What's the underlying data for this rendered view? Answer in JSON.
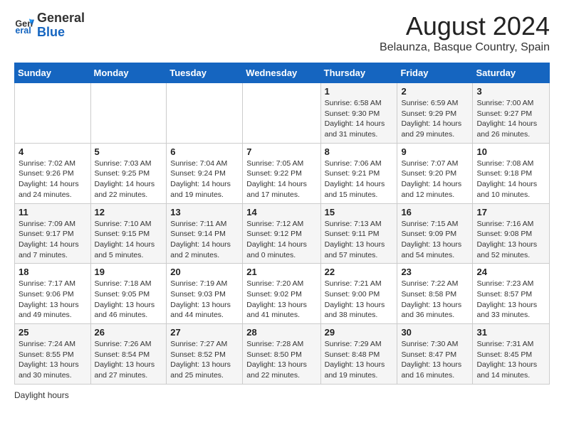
{
  "header": {
    "logo_general": "General",
    "logo_blue": "Blue",
    "month_title": "August 2024",
    "location": "Belaunza, Basque Country, Spain"
  },
  "calendar": {
    "days_of_week": [
      "Sunday",
      "Monday",
      "Tuesday",
      "Wednesday",
      "Thursday",
      "Friday",
      "Saturday"
    ],
    "weeks": [
      [
        {
          "day": "",
          "info": ""
        },
        {
          "day": "",
          "info": ""
        },
        {
          "day": "",
          "info": ""
        },
        {
          "day": "",
          "info": ""
        },
        {
          "day": "1",
          "info": "Sunrise: 6:58 AM\nSunset: 9:30 PM\nDaylight: 14 hours and 31 minutes."
        },
        {
          "day": "2",
          "info": "Sunrise: 6:59 AM\nSunset: 9:29 PM\nDaylight: 14 hours and 29 minutes."
        },
        {
          "day": "3",
          "info": "Sunrise: 7:00 AM\nSunset: 9:27 PM\nDaylight: 14 hours and 26 minutes."
        }
      ],
      [
        {
          "day": "4",
          "info": "Sunrise: 7:02 AM\nSunset: 9:26 PM\nDaylight: 14 hours and 24 minutes."
        },
        {
          "day": "5",
          "info": "Sunrise: 7:03 AM\nSunset: 9:25 PM\nDaylight: 14 hours and 22 minutes."
        },
        {
          "day": "6",
          "info": "Sunrise: 7:04 AM\nSunset: 9:24 PM\nDaylight: 14 hours and 19 minutes."
        },
        {
          "day": "7",
          "info": "Sunrise: 7:05 AM\nSunset: 9:22 PM\nDaylight: 14 hours and 17 minutes."
        },
        {
          "day": "8",
          "info": "Sunrise: 7:06 AM\nSunset: 9:21 PM\nDaylight: 14 hours and 15 minutes."
        },
        {
          "day": "9",
          "info": "Sunrise: 7:07 AM\nSunset: 9:20 PM\nDaylight: 14 hours and 12 minutes."
        },
        {
          "day": "10",
          "info": "Sunrise: 7:08 AM\nSunset: 9:18 PM\nDaylight: 14 hours and 10 minutes."
        }
      ],
      [
        {
          "day": "11",
          "info": "Sunrise: 7:09 AM\nSunset: 9:17 PM\nDaylight: 14 hours and 7 minutes."
        },
        {
          "day": "12",
          "info": "Sunrise: 7:10 AM\nSunset: 9:15 PM\nDaylight: 14 hours and 5 minutes."
        },
        {
          "day": "13",
          "info": "Sunrise: 7:11 AM\nSunset: 9:14 PM\nDaylight: 14 hours and 2 minutes."
        },
        {
          "day": "14",
          "info": "Sunrise: 7:12 AM\nSunset: 9:12 PM\nDaylight: 14 hours and 0 minutes."
        },
        {
          "day": "15",
          "info": "Sunrise: 7:13 AM\nSunset: 9:11 PM\nDaylight: 13 hours and 57 minutes."
        },
        {
          "day": "16",
          "info": "Sunrise: 7:15 AM\nSunset: 9:09 PM\nDaylight: 13 hours and 54 minutes."
        },
        {
          "day": "17",
          "info": "Sunrise: 7:16 AM\nSunset: 9:08 PM\nDaylight: 13 hours and 52 minutes."
        }
      ],
      [
        {
          "day": "18",
          "info": "Sunrise: 7:17 AM\nSunset: 9:06 PM\nDaylight: 13 hours and 49 minutes."
        },
        {
          "day": "19",
          "info": "Sunrise: 7:18 AM\nSunset: 9:05 PM\nDaylight: 13 hours and 46 minutes."
        },
        {
          "day": "20",
          "info": "Sunrise: 7:19 AM\nSunset: 9:03 PM\nDaylight: 13 hours and 44 minutes."
        },
        {
          "day": "21",
          "info": "Sunrise: 7:20 AM\nSunset: 9:02 PM\nDaylight: 13 hours and 41 minutes."
        },
        {
          "day": "22",
          "info": "Sunrise: 7:21 AM\nSunset: 9:00 PM\nDaylight: 13 hours and 38 minutes."
        },
        {
          "day": "23",
          "info": "Sunrise: 7:22 AM\nSunset: 8:58 PM\nDaylight: 13 hours and 36 minutes."
        },
        {
          "day": "24",
          "info": "Sunrise: 7:23 AM\nSunset: 8:57 PM\nDaylight: 13 hours and 33 minutes."
        }
      ],
      [
        {
          "day": "25",
          "info": "Sunrise: 7:24 AM\nSunset: 8:55 PM\nDaylight: 13 hours and 30 minutes."
        },
        {
          "day": "26",
          "info": "Sunrise: 7:26 AM\nSunset: 8:54 PM\nDaylight: 13 hours and 27 minutes."
        },
        {
          "day": "27",
          "info": "Sunrise: 7:27 AM\nSunset: 8:52 PM\nDaylight: 13 hours and 25 minutes."
        },
        {
          "day": "28",
          "info": "Sunrise: 7:28 AM\nSunset: 8:50 PM\nDaylight: 13 hours and 22 minutes."
        },
        {
          "day": "29",
          "info": "Sunrise: 7:29 AM\nSunset: 8:48 PM\nDaylight: 13 hours and 19 minutes."
        },
        {
          "day": "30",
          "info": "Sunrise: 7:30 AM\nSunset: 8:47 PM\nDaylight: 13 hours and 16 minutes."
        },
        {
          "day": "31",
          "info": "Sunrise: 7:31 AM\nSunset: 8:45 PM\nDaylight: 13 hours and 14 minutes."
        }
      ]
    ]
  },
  "footer": {
    "note": "Daylight hours"
  }
}
